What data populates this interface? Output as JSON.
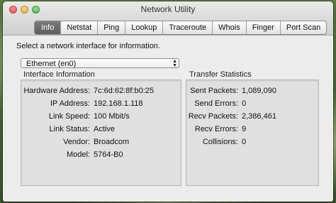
{
  "window": {
    "title": "Network Utility"
  },
  "tabs": [
    "Info",
    "Netstat",
    "Ping",
    "Lookup",
    "Traceroute",
    "Whois",
    "Finger",
    "Port Scan"
  ],
  "active_tab": "Info",
  "prompt": "Select a network interface for information.",
  "interface_select": {
    "value": "Ethernet (en0)"
  },
  "interface_info": {
    "heading": "Interface Information",
    "rows": [
      {
        "label": "Hardware Address:",
        "value": "7c:6d:62:8f:b0:25"
      },
      {
        "label": "IP Address:",
        "value": "192.168.1.118"
      },
      {
        "label": "Link Speed:",
        "value": "100 Mbit/s"
      },
      {
        "label": "Link Status:",
        "value": "Active"
      },
      {
        "label": "Vendor:",
        "value": "Broadcom"
      },
      {
        "label": "Model:",
        "value": "5764-B0"
      }
    ]
  },
  "transfer_stats": {
    "heading": "Transfer Statistics",
    "rows": [
      {
        "label": "Sent Packets:",
        "value": "1,089,090"
      },
      {
        "label": "Send Errors:",
        "value": "0"
      },
      {
        "label": "Recv Packets:",
        "value": "2,386,461"
      },
      {
        "label": "Recv Errors:",
        "value": "9"
      },
      {
        "label": "Collisions:",
        "value": "0"
      }
    ]
  }
}
